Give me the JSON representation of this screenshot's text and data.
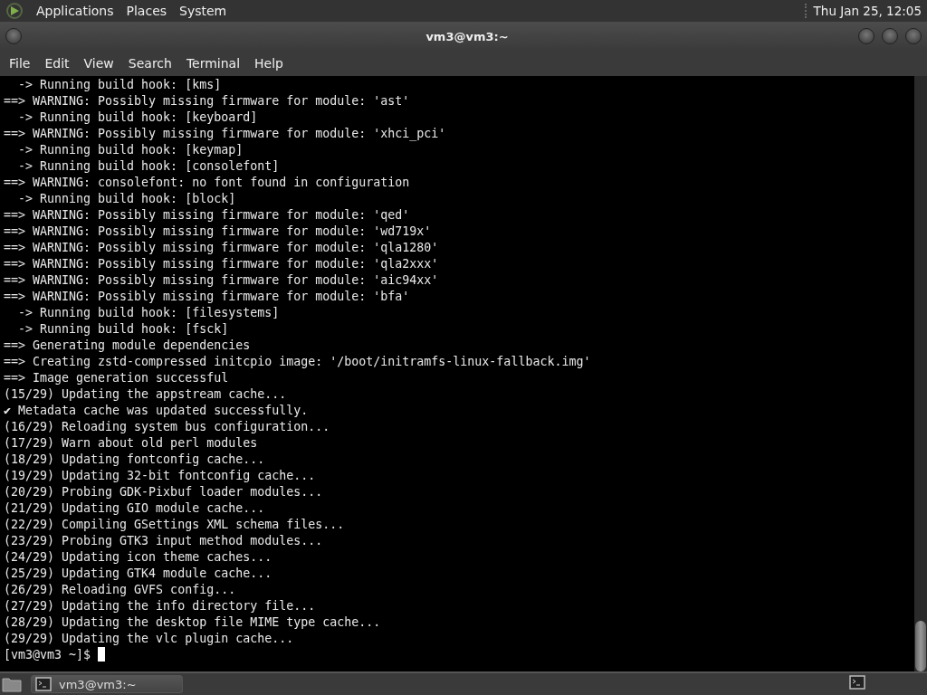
{
  "top_panel": {
    "menus": [
      "Applications",
      "Places",
      "System"
    ],
    "clock": "Thu Jan 25, 12:05"
  },
  "window": {
    "title": "vm3@vm3:~"
  },
  "menu_bar": [
    "File",
    "Edit",
    "View",
    "Search",
    "Terminal",
    "Help"
  ],
  "terminal": {
    "lines": [
      "  -> Running build hook: [kms]",
      "==> WARNING: Possibly missing firmware for module: 'ast'",
      "  -> Running build hook: [keyboard]",
      "==> WARNING: Possibly missing firmware for module: 'xhci_pci'",
      "  -> Running build hook: [keymap]",
      "  -> Running build hook: [consolefont]",
      "==> WARNING: consolefont: no font found in configuration",
      "  -> Running build hook: [block]",
      "==> WARNING: Possibly missing firmware for module: 'qed'",
      "==> WARNING: Possibly missing firmware for module: 'wd719x'",
      "==> WARNING: Possibly missing firmware for module: 'qla1280'",
      "==> WARNING: Possibly missing firmware for module: 'qla2xxx'",
      "==> WARNING: Possibly missing firmware for module: 'aic94xx'",
      "==> WARNING: Possibly missing firmware for module: 'bfa'",
      "  -> Running build hook: [filesystems]",
      "  -> Running build hook: [fsck]",
      "==> Generating module dependencies",
      "==> Creating zstd-compressed initcpio image: '/boot/initramfs-linux-fallback.img'",
      "==> Image generation successful",
      "(15/29) Updating the appstream cache...",
      "✔ Metadata cache was updated successfully.",
      "(16/29) Reloading system bus configuration...",
      "(17/29) Warn about old perl modules",
      "(18/29) Updating fontconfig cache...",
      "(19/29) Updating 32-bit fontconfig cache...",
      "(20/29) Probing GDK-Pixbuf loader modules...",
      "(21/29) Updating GIO module cache...",
      "(22/29) Compiling GSettings XML schema files...",
      "(23/29) Probing GTK3 input method modules...",
      "(24/29) Updating icon theme caches...",
      "(25/29) Updating GTK4 module cache...",
      "(26/29) Reloading GVFS config...",
      "(27/29) Updating the info directory file...",
      "(28/29) Updating the desktop file MIME type cache...",
      "(29/29) Updating the vlc plugin cache..."
    ],
    "prompt": "[vm3@vm3 ~]$"
  },
  "taskbar": {
    "tasks": [
      {
        "label": "vm3@vm3:~"
      }
    ]
  }
}
